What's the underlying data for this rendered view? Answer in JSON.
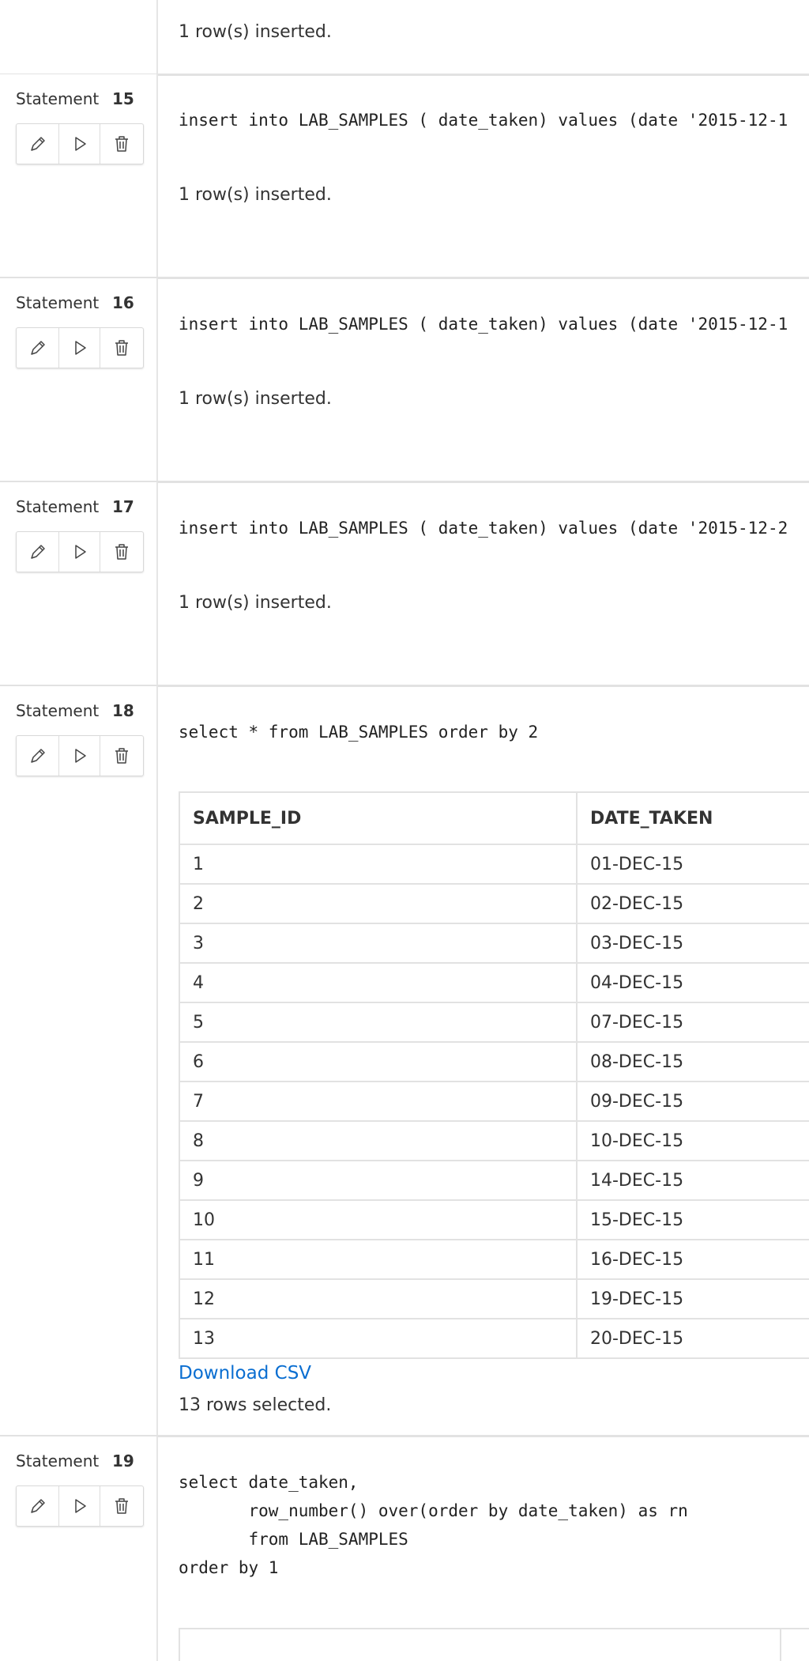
{
  "labels": {
    "statement": "Statement",
    "download_csv": "Download CSV"
  },
  "icons": {
    "edit": "pencil-icon",
    "run": "play-icon",
    "delete": "trash-icon"
  },
  "top_message": "1 row(s) inserted.",
  "statements": [
    {
      "number": "15",
      "code": "insert into LAB_SAMPLES ( date_taken) values (date '2015-12-1",
      "message": "1 row(s) inserted."
    },
    {
      "number": "16",
      "code": "insert into LAB_SAMPLES ( date_taken) values (date '2015-12-1",
      "message": "1 row(s) inserted."
    },
    {
      "number": "17",
      "code": "insert into LAB_SAMPLES ( date_taken) values (date '2015-12-2",
      "message": "1 row(s) inserted."
    },
    {
      "number": "18",
      "code": "select * from LAB_SAMPLES order by 2",
      "table": {
        "columns": [
          "SAMPLE_ID",
          "DATE_TAKEN"
        ],
        "rows": [
          [
            "1",
            "01-DEC-15"
          ],
          [
            "2",
            "02-DEC-15"
          ],
          [
            "3",
            "03-DEC-15"
          ],
          [
            "4",
            "04-DEC-15"
          ],
          [
            "5",
            "07-DEC-15"
          ],
          [
            "6",
            "08-DEC-15"
          ],
          [
            "7",
            "09-DEC-15"
          ],
          [
            "8",
            "10-DEC-15"
          ],
          [
            "9",
            "14-DEC-15"
          ],
          [
            "10",
            "15-DEC-15"
          ],
          [
            "11",
            "16-DEC-15"
          ],
          [
            "12",
            "19-DEC-15"
          ],
          [
            "13",
            "20-DEC-15"
          ]
        ]
      },
      "message": "13 rows selected."
    },
    {
      "number": "19",
      "code_lines": [
        "select date_taken,",
        "       row_number() over(order by date_taken) as rn",
        "       from LAB_SAMPLES",
        "order by 1"
      ]
    }
  ]
}
